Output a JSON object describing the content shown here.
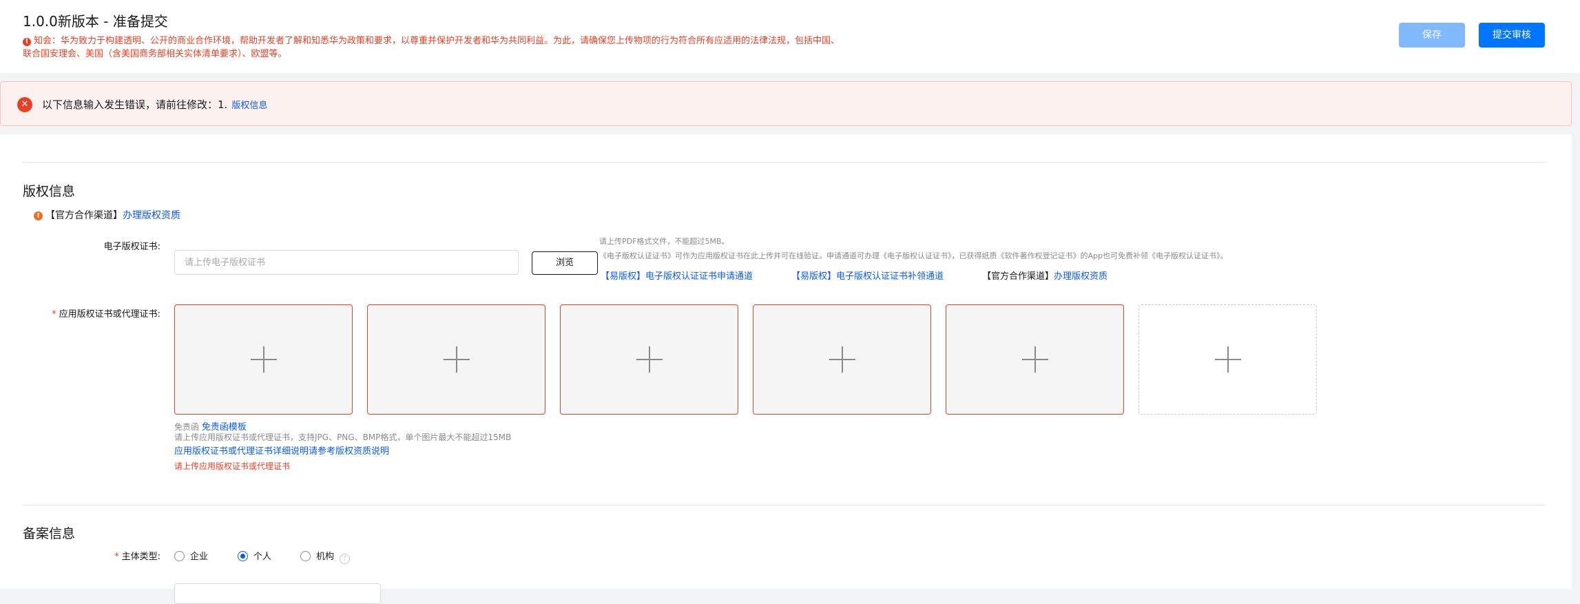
{
  "header": {
    "title": "1.0.0新版本 - 准备提交",
    "notice_icon": "!",
    "notice": "知会：华为致力于构建透明、公开的商业合作环境，帮助开发者了解和知悉华为政策和要求，以尊重并保护开发者和华为共同利益。为此，请确保您上传物项的行为符合所有应适用的法律法规，包括中国、联合国安理会、美国（含美国商务部相关实体清单要求）、欧盟等。",
    "save_label": "保存",
    "submit_label": "提交审核"
  },
  "error_banner": {
    "icon": "✕",
    "text": "以下信息输入发生错误，请前往修改：1.",
    "link": "版权信息"
  },
  "copyright": {
    "section_title": "版权信息",
    "tip_icon": "!",
    "tip_prefix": "【官方合作渠道】",
    "tip_link": "办理版权资质",
    "ecert_label": "电子版权证书:",
    "ecert_placeholder": "请上传电子版权证书",
    "browse_label": "浏览",
    "hint_line1": "请上传PDF格式文件，不能超过5MB。",
    "hint_line2": "《电子版权认证证书》可作为应用版权证书在此上传并可在线验证。申请通道可办理《电子版权认证证书》，已获得纸质《软件著作权登记证书》的App也可免费补领《电子版权认证证书》。",
    "channel_links": [
      {
        "prefix": "【易版权】",
        "link": "电子版权认证证书申请通道"
      },
      {
        "prefix": "【易版权】",
        "link": "电子版权认证证书补领通道"
      },
      {
        "prefix": "【官方合作渠道】",
        "link": "办理版权资质"
      }
    ],
    "app_cert_label": "应用版权证书或代理证书:",
    "required_mark": "*",
    "disclaimer_prefix": "免责函",
    "disclaimer_link": "免责函模板",
    "upload_hint": "请上传应用版权证书或代理证书，支持JPG、PNG、BMP格式，单个图片最大不能超过15MB",
    "detail_link": "应用版权证书或代理证书详细说明请参考版权资质说明",
    "error_text": "请上传应用版权证书或代理证书"
  },
  "filing": {
    "section_title": "备案信息",
    "entity_label": "主体类型:",
    "required_mark": "*",
    "options": [
      {
        "label": "企业",
        "checked": false
      },
      {
        "label": "个人",
        "checked": true
      },
      {
        "label": "机构",
        "checked": false
      }
    ],
    "help_icon": "?"
  }
}
